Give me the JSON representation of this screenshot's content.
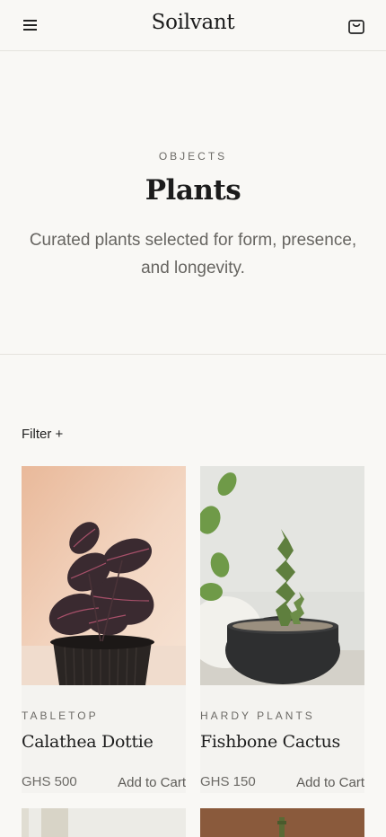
{
  "header": {
    "brand": "Soilvant"
  },
  "hero": {
    "eyebrow": "OBJECTS",
    "title": "Plants",
    "subtitle": "Curated plants selected for form, presence, and longevity."
  },
  "filter_label": "Filter +",
  "products": [
    {
      "category": "TABLETOP",
      "name": "Calathea Dottie",
      "price": "GHS 500",
      "cta": "Add to Cart"
    },
    {
      "category": "HARDY PLANTS",
      "name": "Fishbone Cactus",
      "price": "GHS 150",
      "cta": "Add to Cart"
    }
  ],
  "colors": {
    "background": "#f9f8f5",
    "text": "#1f1f1f",
    "muted": "#6c6a66",
    "divider": "#e5e3de"
  }
}
